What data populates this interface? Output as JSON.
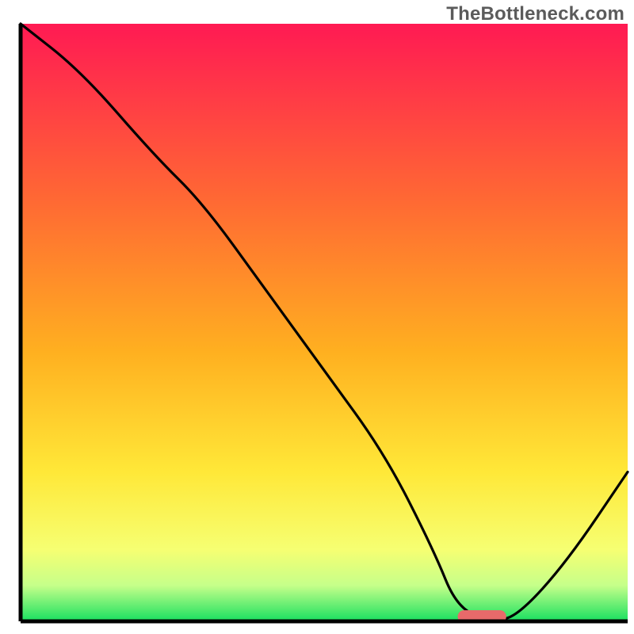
{
  "watermark": "TheBottleneck.com",
  "chart_data": {
    "type": "line",
    "title": "",
    "xlabel": "",
    "ylabel": "",
    "xlim": [
      0,
      100
    ],
    "ylim": [
      0,
      100
    ],
    "x": [
      0,
      10,
      22,
      30,
      40,
      50,
      60,
      68,
      72,
      78,
      82,
      90,
      100
    ],
    "values": [
      100,
      92,
      78,
      70,
      56,
      42,
      28,
      12,
      2,
      0,
      1,
      10,
      25
    ],
    "marker": {
      "x_start": 72,
      "x_end": 80,
      "y": 0
    },
    "gradient_stops": [
      {
        "offset": 0,
        "color": "#ff1a53"
      },
      {
        "offset": 30,
        "color": "#ff6a33"
      },
      {
        "offset": 55,
        "color": "#ffb020"
      },
      {
        "offset": 75,
        "color": "#ffe838"
      },
      {
        "offset": 88,
        "color": "#f6ff72"
      },
      {
        "offset": 94,
        "color": "#c6ff8a"
      },
      {
        "offset": 100,
        "color": "#18e060"
      }
    ],
    "axis_color": "#000000",
    "line_color": "#000000",
    "marker_color": "#e86a6a"
  }
}
